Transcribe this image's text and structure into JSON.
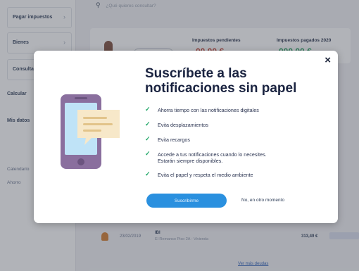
{
  "sidebar": {
    "items": [
      {
        "label": "Pagar impuestos"
      },
      {
        "label": "Bienes"
      },
      {
        "label": "Consultar"
      },
      {
        "label": "Calcular"
      },
      {
        "label": "Mis datos"
      }
    ],
    "links": [
      "Calendario",
      "Ahorro"
    ]
  },
  "search": {
    "placeholder": "¿Qué quieres consultar?"
  },
  "summary": {
    "pending_label": "Impuestos pendientes",
    "pending_value": "00,00 €",
    "paid_label": "Impuestos pagados 2020",
    "paid_value": "000,00 €"
  },
  "list": {
    "row": {
      "date": "23/02/2019",
      "code": "IBI",
      "desc": "El Remanso Piso 2A - Vivienda",
      "amount": "313,49 €"
    },
    "more": "Ver más deudas"
  },
  "modal": {
    "title": "Suscríbete a las notificaciones sin papel",
    "benefits": [
      "Ahorra tiempo con las notificaciones digitales",
      "Evita desplazamientos",
      "Evita recargos",
      "Accede a tus notificaciones cuando lo necesites. Estarán siempre disponibles.",
      "Evita el papel y respeta el medio ambiente"
    ],
    "subscribe_label": "Suscribirme",
    "later_label": "No, en otro momento",
    "close_glyph": "×"
  },
  "colors": {
    "accent": "#2a90df",
    "check": "#24a86a",
    "title": "#1a2340",
    "phone_body": "#8a6f9e",
    "phone_screen": "#bfe3f7",
    "bubble": "#f7e8c9"
  },
  "icons": {
    "search": "search-icon",
    "close": "close-icon",
    "check": "check-icon",
    "illustration": "phone-notification-illustration"
  }
}
